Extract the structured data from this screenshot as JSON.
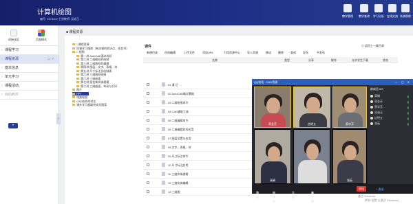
{
  "app": {
    "title": "计算机绘图",
    "subtitle": "编号: 5373402   主讲教师: 吴诚玉"
  },
  "top_nav": [
    "教学管理",
    "教学查询",
    "学习分析",
    "在线交流",
    "系统帮助"
  ],
  "sidebar": {
    "tools": [
      "初始化区",
      "页面模式"
    ],
    "items": [
      {
        "label": "课程学习",
        "state": "normal"
      },
      {
        "label": "课程资源",
        "state": "active"
      },
      {
        "label": "基本信息",
        "state": "normal"
      },
      {
        "label": "单元学习",
        "state": "normal"
      },
      {
        "label": "课程活动",
        "state": "normal"
      },
      {
        "label": "我的教学",
        "state": "muted"
      }
    ],
    "add_label": "+"
  },
  "breadcrumb": "课程资源",
  "tree": [
    "□ 课程资源",
    "  同课学习指南（每次课的知识点、任务书）",
    "  □ 视频",
    "    第一讲 AutoCAD基本知识",
    "    第二讲 二维图形的绘制",
    "    第三讲 二维图形的编辑",
    "    第四讲 图层、文字、表格、块",
    "    第五讲 尺寸标注及绘制表",
    "    第六讲 三维图形绘制",
    "    第六讲 三维曲面",
    "    第七讲 组合体实体建模",
    "    第六讲 三维曲面、布局与打印",
    "  图片",
    "  PPT",
    "  电路绘图",
    "  CAD软件的对比",
    "  课外学习超级完成无图案"
  ],
  "table": {
    "label": "课件",
    "back_link": "返回上一级目录",
    "toolbar": [
      "新建目录",
      "在线编辑",
      "上传文件",
      "添加URL",
      "引用资源中心",
      "导入资源",
      "移动",
      "删除",
      "查询",
      "发布",
      "不发布"
    ],
    "columns": [
      "名称",
      "类型",
      "分享",
      "操作",
      "允许学生下载",
      "状态"
    ],
    "rows": [
      "01 漫 记",
      "02 AutoCAD概况基础",
      "03 二维绘图命令",
      "04 CAD辅助工具",
      "05 二维编辑命令",
      "06 二维编辑综合应用",
      "07 图层设置与应用",
      "08 文字、表格、块",
      "09 尺寸标注命令",
      "10 尺寸标注应用",
      "11 三维实体建模",
      "12 三维实体编辑",
      "13 三维图"
    ]
  },
  "video_call": {
    "title": "QQ电话 - CAD资源",
    "participants": [
      "蒋金芬",
      "信明五",
      "蔡学芳",
      "高娟",
      "",
      "张茹"
    ],
    "members_header": "群成员 6/9",
    "members": [
      "高娟",
      "蒋金芬",
      "蔡学芳",
      "吴诚玉",
      "信明五",
      "张茹"
    ],
    "footer": [
      "静音",
      "摄像头",
      "全屏",
      "画中画"
    ],
    "leave_label": "退出",
    "add_label": "+ 邀请"
  },
  "watermark": {
    "line1": "激活 Windows",
    "line2": "转到\"设置\"以激活 Windows。"
  },
  "colors": {
    "header_bg": "#1d2f86",
    "accent": "#2a3c92",
    "video_header": "#2a5fbf",
    "leave": "#e0332f"
  }
}
